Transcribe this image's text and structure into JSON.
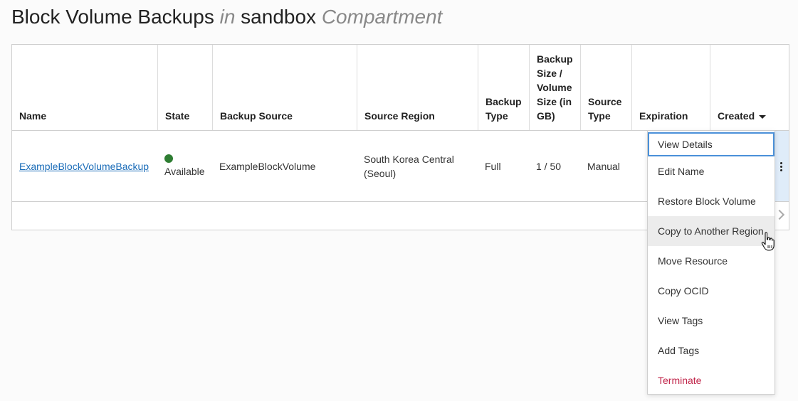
{
  "page": {
    "title_main": "Block Volume Backups",
    "title_in": "in",
    "title_compartment_name": "sandbox",
    "title_compartment_word": "Compartment"
  },
  "table": {
    "columns": [
      {
        "key": "name",
        "label": "Name"
      },
      {
        "key": "state",
        "label": "State"
      },
      {
        "key": "backup_source",
        "label": "Backup Source"
      },
      {
        "key": "source_region",
        "label": "Source Region"
      },
      {
        "key": "backup_type",
        "label": "Backup Type"
      },
      {
        "key": "size",
        "label": "Backup Size / Volume Size (in GB)"
      },
      {
        "key": "source_type",
        "label": "Source Type"
      },
      {
        "key": "expiration",
        "label": "Expiration"
      },
      {
        "key": "created",
        "label": "Created"
      }
    ],
    "rows": [
      {
        "name": "ExampleBlockVolumeBackup",
        "state": "Available",
        "backup_source": "ExampleBlockVolume",
        "source_region": "South Korea Central (Seoul)",
        "backup_type": "Full",
        "size": "1 / 50",
        "source_type": "Manual",
        "expiration": "",
        "created": ""
      }
    ],
    "sort_column": "created",
    "sort_direction": "descending"
  },
  "actions_menu": {
    "items": [
      {
        "label": "View Details",
        "state": "focused"
      },
      {
        "label": "Edit Name",
        "state": "normal"
      },
      {
        "label": "Restore Block Volume",
        "state": "normal"
      },
      {
        "label": "Copy to Another Region",
        "state": "hovered"
      },
      {
        "label": "Move Resource",
        "state": "normal"
      },
      {
        "label": "Copy OCID",
        "state": "normal"
      },
      {
        "label": "View Tags",
        "state": "normal"
      },
      {
        "label": "Add Tags",
        "state": "normal"
      },
      {
        "label": "Terminate",
        "state": "danger"
      }
    ]
  },
  "colors": {
    "link": "#1a6cb8",
    "status_available": "#2e7d32",
    "danger": "#c0254a",
    "focus_border": "#4a90d9",
    "hover_bg": "#ececec",
    "selected_row_bg": "#dfecf9"
  },
  "icons": {
    "status": "status-dot-icon",
    "sort": "caret-down-icon",
    "row_actions": "kebab-menu-icon",
    "pager": "chevron-right-icon",
    "cursor": "hand-pointer-cursor-icon"
  }
}
